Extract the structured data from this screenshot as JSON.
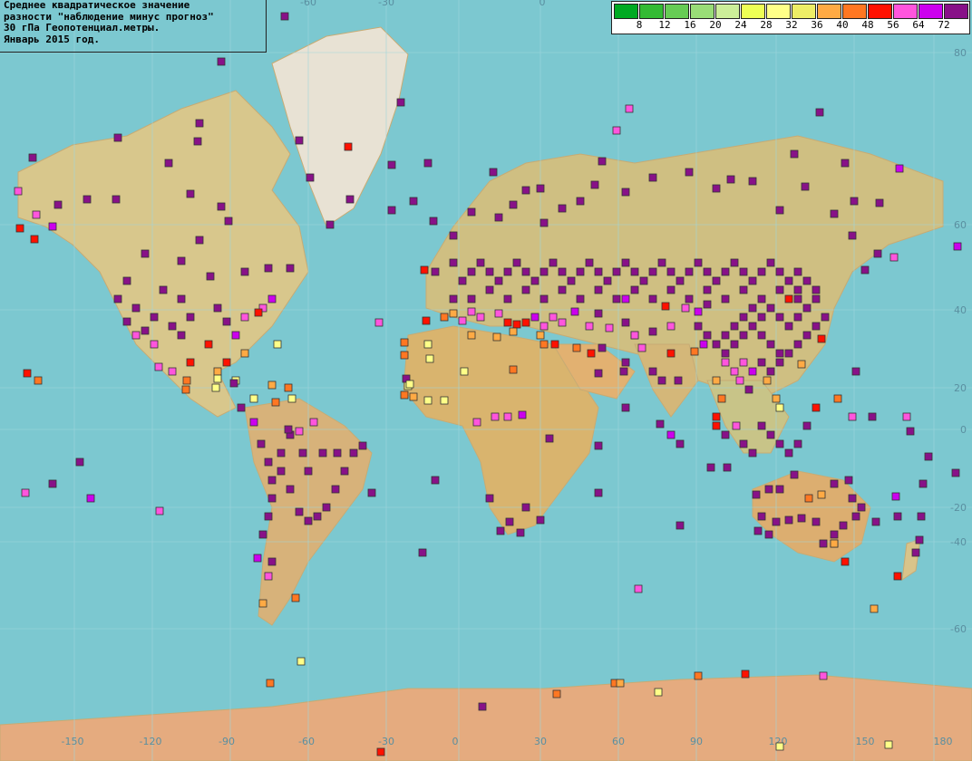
{
  "title_lines": [
    "Среднее квадратическое значение",
    "разности \"наблюдение минус прогноз\"",
    "30 гПа Геопотенциал.метры.",
    "Январь 2015 год."
  ],
  "legend": {
    "colors": [
      "#00aa22",
      "#33bb33",
      "#66cc55",
      "#99dd77",
      "#ccee99",
      "#eeff55",
      "#ffff88",
      "#eeee66",
      "#ffaa44",
      "#ff7722",
      "#ff1100",
      "#ff55dd",
      "#cc00ee",
      "#881188"
    ],
    "labels": [
      "8",
      "12",
      "16",
      "20",
      "24",
      "28",
      "32",
      "36",
      "40",
      "48",
      "56",
      "64",
      "72"
    ]
  },
  "axes": {
    "lon_labels": [
      "-150",
      "-120",
      "-90",
      "-60",
      "-30",
      "0",
      "30",
      "60",
      "90",
      "120",
      "150",
      "180"
    ],
    "lon_labels_top": [
      "-60",
      "-30",
      "0"
    ],
    "lat_labels": [
      "80",
      "60",
      "40",
      "20",
      "0",
      "-20",
      "-40",
      "-60"
    ]
  },
  "stations": {
    "default_color": "#881188",
    "summary": "Station markers colored by RMS value bins (legend)."
  }
}
